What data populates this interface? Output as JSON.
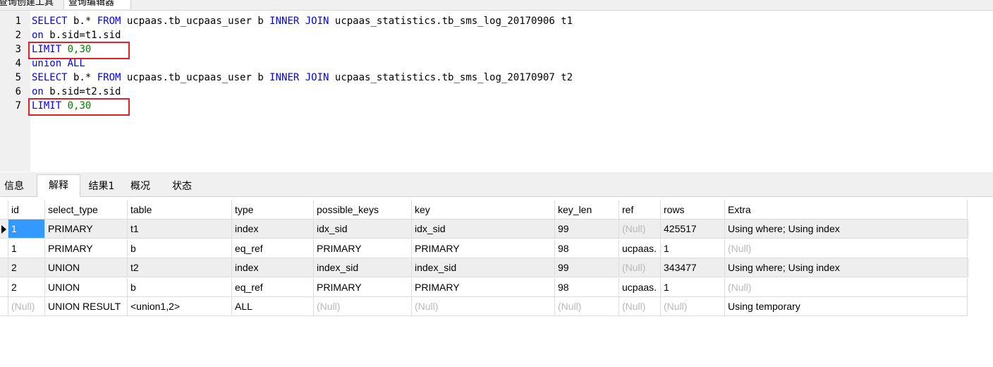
{
  "top_tabs": [
    "查询创建工具",
    "查询编辑器"
  ],
  "editor": {
    "lines": [
      {
        "n": "1",
        "tokens": [
          [
            "kw",
            "SELECT"
          ],
          [
            "id",
            " b.* "
          ],
          [
            "kw",
            "FROM"
          ],
          [
            "id",
            " ucpaas.tb_ucpaas_user b "
          ],
          [
            "kw",
            "INNER JOIN"
          ],
          [
            "id",
            " ucpaas_statistics.tb_sms_log_20170906 t1"
          ]
        ]
      },
      {
        "n": "2",
        "tokens": [
          [
            "kw",
            "on"
          ],
          [
            "id",
            " b.sid=t1.sid"
          ]
        ]
      },
      {
        "n": "3",
        "tokens": [
          [
            "kw",
            "LIMIT"
          ],
          [
            "num",
            " 0,30"
          ]
        ]
      },
      {
        "n": "4",
        "tokens": [
          [
            "kw",
            "union ALL"
          ]
        ]
      },
      {
        "n": "5",
        "tokens": [
          [
            "kw",
            "SELECT"
          ],
          [
            "id",
            " b.* "
          ],
          [
            "kw",
            "FROM"
          ],
          [
            "id",
            " ucpaas.tb_ucpaas_user b "
          ],
          [
            "kw",
            "INNER JOIN"
          ],
          [
            "id",
            " ucpaas_statistics.tb_sms_log_20170907 t2"
          ]
        ]
      },
      {
        "n": "6",
        "tokens": [
          [
            "kw",
            "on"
          ],
          [
            "id",
            " b.sid=t2.sid"
          ]
        ]
      },
      {
        "n": "7",
        "tokens": [
          [
            "kw",
            "LIMIT"
          ],
          [
            "num",
            " 0,30"
          ]
        ]
      }
    ],
    "highlighted_lines": [
      "3",
      "7"
    ],
    "highlight_color": "#e0202a"
  },
  "panel_tabs": [
    {
      "label": "信息",
      "active": false
    },
    {
      "label": "解释",
      "active": true
    },
    {
      "label": "结果1",
      "active": false
    },
    {
      "label": "概况",
      "active": false
    },
    {
      "label": "状态",
      "active": false
    }
  ],
  "grid": {
    "columns": [
      "id",
      "select_type",
      "table",
      "type",
      "possible_keys",
      "key",
      "key_len",
      "ref",
      "rows",
      "Extra"
    ],
    "rows": [
      [
        "1",
        "PRIMARY",
        "t1",
        "index",
        "idx_sid",
        "idx_sid",
        "99",
        "(Null)",
        "425517",
        "Using where; Using index"
      ],
      [
        "1",
        "PRIMARY",
        "b",
        "eq_ref",
        "PRIMARY",
        "PRIMARY",
        "98",
        "ucpaas.",
        "1",
        "(Null)"
      ],
      [
        "2",
        "UNION",
        "t2",
        "index",
        "index_sid",
        "index_sid",
        "99",
        "(Null)",
        "343477",
        "Using where; Using index"
      ],
      [
        "2",
        "UNION",
        "b",
        "eq_ref",
        "PRIMARY",
        "PRIMARY",
        "98",
        "ucpaas.",
        "1",
        "(Null)"
      ],
      [
        "(Null)",
        "UNION RESULT",
        "<union1,2>",
        "ALL",
        "(Null)",
        "(Null)",
        "(Null)",
        "(Null)",
        "(Null)",
        "Using temporary"
      ]
    ],
    "selected_row": 0,
    "null_text": "(Null)"
  }
}
